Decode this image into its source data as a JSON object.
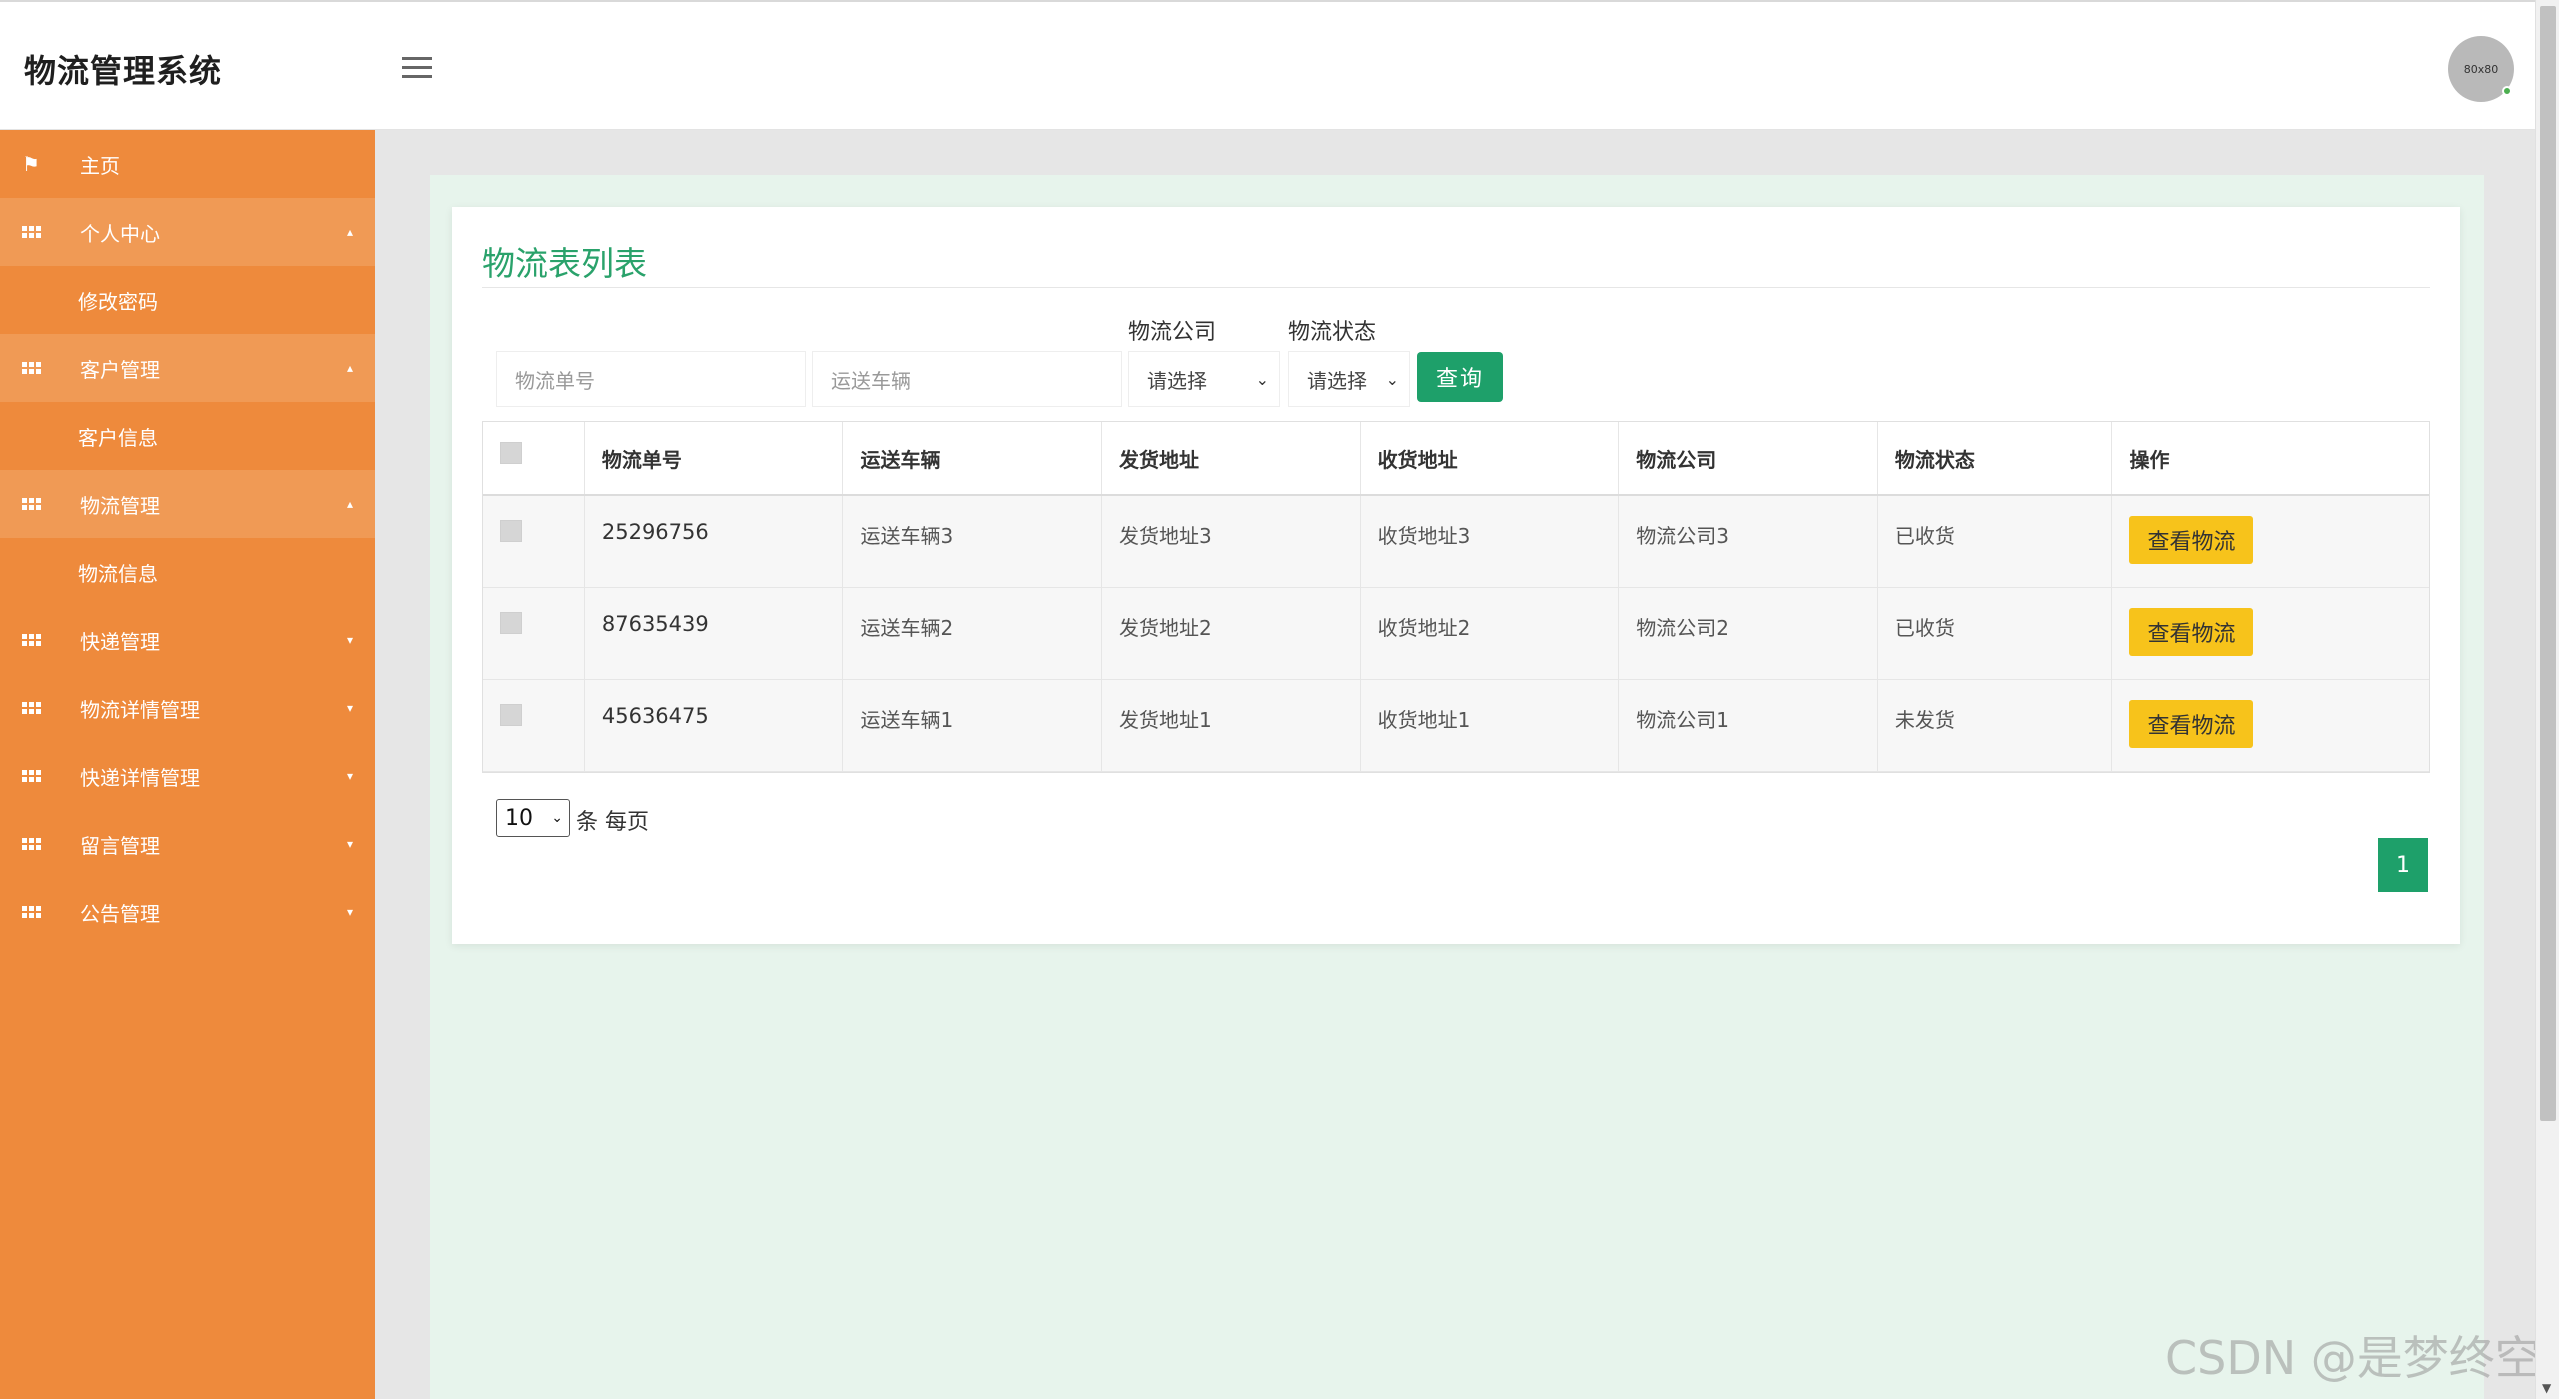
{
  "header": {
    "app_title": "物流管理系统",
    "avatar_text": "80x80"
  },
  "sidebar": {
    "items": [
      {
        "label": "主页",
        "icon": "flag-icon"
      },
      {
        "label": "个人中心",
        "icon": "grid-icon"
      },
      {
        "label": "修改密码"
      },
      {
        "label": "客户管理",
        "icon": "grid-icon"
      },
      {
        "label": "客户信息"
      },
      {
        "label": "物流管理",
        "icon": "grid-icon"
      },
      {
        "label": "物流信息"
      },
      {
        "label": "快递管理",
        "icon": "grid-icon"
      },
      {
        "label": "物流详情管理",
        "icon": "grid-icon"
      },
      {
        "label": "快递详情管理",
        "icon": "grid-icon"
      },
      {
        "label": "留言管理",
        "icon": "grid-icon"
      },
      {
        "label": "公告管理",
        "icon": "grid-icon"
      }
    ]
  },
  "main": {
    "title": "物流表列表",
    "filters": {
      "tracking_placeholder": "物流单号",
      "vehicle_placeholder": "运送车辆",
      "company_label": "物流公司",
      "company_value": "请选择",
      "status_label": "物流状态",
      "status_value": "请选择",
      "search_label": "查询"
    },
    "table": {
      "headers": [
        "物流单号",
        "运送车辆",
        "发货地址",
        "收货地址",
        "物流公司",
        "物流状态",
        "操作"
      ],
      "rows": [
        {
          "tracking": "25296756",
          "vehicle": "运送车辆3",
          "from": "发货地址3",
          "to": "收货地址3",
          "company": "物流公司3",
          "status": "已收货",
          "action": "查看物流"
        },
        {
          "tracking": "87635439",
          "vehicle": "运送车辆2",
          "from": "发货地址2",
          "to": "收货地址2",
          "company": "物流公司2",
          "status": "已收货",
          "action": "查看物流"
        },
        {
          "tracking": "45636475",
          "vehicle": "运送车辆1",
          "from": "发货地址1",
          "to": "收货地址1",
          "company": "物流公司1",
          "status": "未发货",
          "action": "查看物流"
        }
      ]
    },
    "pagination": {
      "page_size": "10",
      "per_page_label": "条 每页",
      "current_page": "1"
    }
  },
  "watermark": "CSDN @是梦终空",
  "colors": {
    "sidebar": "#ee8a3c",
    "accent_green": "#1ea06a",
    "button_yellow": "#f7c31b"
  }
}
